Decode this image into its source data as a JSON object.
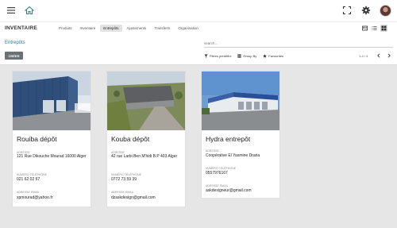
{
  "topbar": {
    "menu_icon": "hamburger-menu-icon",
    "home_icon": "home-icon",
    "expand_icon": "expand-icon",
    "settings_icon": "gear-icon",
    "avatar": "user-avatar"
  },
  "app": {
    "title": "INVENTAIRE",
    "nav": [
      "Produits",
      "Inventaire",
      "Entrepôts",
      "Ajustements",
      "Transferts",
      "Organisation"
    ],
    "active_nav": "Entrepôts"
  },
  "control": {
    "breadcrumb": "Entrepôts",
    "create_label": "CRÉER",
    "search_placeholder": "search...",
    "filters_label": "Filtres prédéfini",
    "group_by_label": "Group By",
    "favorites_label": "Favourites",
    "pager": "1-4 / 4"
  },
  "colors": {
    "accent": "#2a7f8f",
    "create_btn": "#6a7273",
    "background": "#e6e6e6"
  },
  "cards": [
    {
      "title": "Rouiba dépôt",
      "address_label": "ADRESSE",
      "address": "121 Rue Dikouche Mourad 16000 Alger",
      "phone_label": "NUMÉRO TÉLÉPHONE",
      "phone": "021 62 02 67",
      "email_label": "ADRESSE EMAIL",
      "email": "xpmourad@yahoo.fr"
    },
    {
      "title": "Kouba dépôt",
      "address_label": "ADRESSE",
      "address": "42 rue Larbi Ben M'hidi B.P 403 Alger",
      "phone_label": "NUMÉRO TÉLÉPHONE",
      "phone": "0772 73 59 39",
      "email_label": "ADRESSE EMAIL",
      "email": "dzaskdesign@gmail.com"
    },
    {
      "title": "Hydra entrepôt",
      "address_label": "ADRESSE",
      "address": "Coopérative El Yasmine Draria",
      "phone_label": "NUMÉRO TÉLÉPHONE",
      "phone": "0557976167",
      "email_label": "ADRESSE EMAIL",
      "email": "askdesigneur@gmail.com"
    }
  ]
}
